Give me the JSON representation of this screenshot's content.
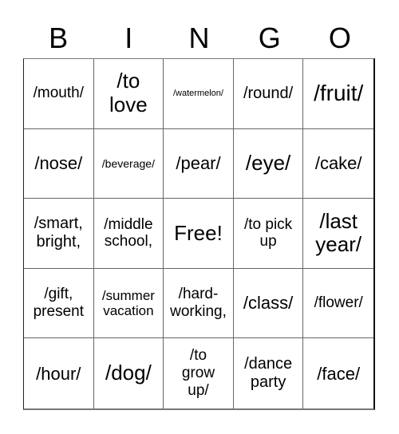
{
  "header": {
    "letters": [
      "B",
      "I",
      "N",
      "G",
      "O"
    ]
  },
  "board": {
    "rows": [
      [
        "/mouth/",
        "/to love",
        "/watermelon/",
        "/round/",
        "/fruit/"
      ],
      [
        "/nose/",
        "/beverage/",
        "/pear/",
        "/eye/",
        "/cake/"
      ],
      [
        "/smart, bright,",
        "/middle school,",
        "Free!",
        "/to pick up",
        "/last year/"
      ],
      [
        "/gift, present",
        "/summer vacation",
        "/hard-working,",
        "/class/",
        "/flower/"
      ],
      [
        "/hour/",
        "/dog/",
        "/to grow up/",
        "/dance party",
        "/face/"
      ]
    ]
  }
}
